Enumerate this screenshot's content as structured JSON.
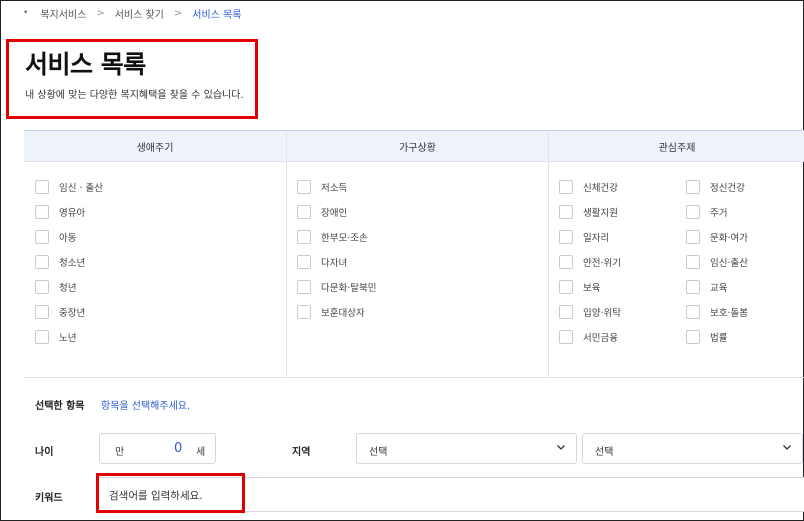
{
  "breadcrumb": {
    "bullet": "•",
    "items": [
      "복지서비스",
      "서비스 찾기",
      "서비스 목록"
    ],
    "separator": ">"
  },
  "header": {
    "title": "서비스 목록",
    "subtitle": "내 상황에 맞는 다양한 복지혜택을 찾을 수 있습니다."
  },
  "filters": {
    "lifecycle": {
      "header": "생애주기",
      "items": [
        "임신 · 출산",
        "영유아",
        "아동",
        "청소년",
        "청년",
        "중장년",
        "노년"
      ]
    },
    "household": {
      "header": "가구상황",
      "items": [
        "저소득",
        "장애인",
        "한부모·조손",
        "다자녀",
        "다문화·탈북민",
        "보훈대상자"
      ]
    },
    "interest": {
      "header": "관심주제",
      "col1": [
        "신체건강",
        "생활지원",
        "일자리",
        "안전·위기",
        "보육",
        "입양·위탁",
        "서민금융"
      ],
      "col2": [
        "정신건강",
        "주거",
        "문화·여가",
        "임신·출산",
        "교육",
        "보호·돌봄",
        "법률"
      ]
    }
  },
  "selected": {
    "label": "선택한 항목",
    "hint": "항목을 선택해주세요."
  },
  "age": {
    "label": "나이",
    "prefix": "만",
    "value": "0",
    "unit": "세"
  },
  "region": {
    "label": "지역",
    "select1": "선택",
    "select2": "선택"
  },
  "keyword": {
    "label": "키워드",
    "placeholder": "검색어를 입력하세요."
  },
  "colors": {
    "accent": "#2d5bd3",
    "highlight": "#e00000",
    "header_bg": "#eef2fb"
  }
}
